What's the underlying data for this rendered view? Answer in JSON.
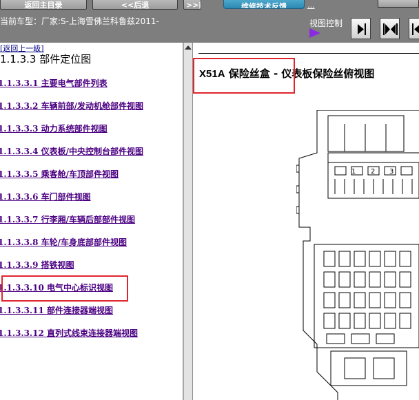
{
  "toolbar": {
    "home_label": "返回主目录",
    "back_label": "<<后退",
    "forward_label": ">>前进",
    "tech_feedback_label": "维修技术反馈",
    "tech_feedback_link": "...",
    "model_label": "当前车型：厂家:S-上海雪佛兰科鲁兹2011-",
    "view_control_label": "视图控制"
  },
  "nav": {
    "up_link": "[返回上一级]",
    "section_title": "1.1.3.3 部件定位图",
    "items": [
      {
        "label": "1.1.3.3.1 主要电气部件列表"
      },
      {
        "label": "1.1.3.3.2 车辆前部/发动机舱部件视图"
      },
      {
        "label": "1.1.3.3.3 动力系统部件视图"
      },
      {
        "label": "1.1.3.3.4 仪表板/中央控制台部件视图"
      },
      {
        "label": "1.1.3.3.5 乘客舱/车顶部件视图"
      },
      {
        "label": "1.1.3.3.6 车门部件视图"
      },
      {
        "label": "1.1.3.3.7 行李厢/车辆后部部件视图"
      },
      {
        "label": "1.1.3.3.8 车轮/车身底部部件视图"
      },
      {
        "label": "1.1.3.3.9 搭铁视图"
      },
      {
        "label": "1.1.3.3.10 电气中心标识视图"
      },
      {
        "label": "1.1.3.3.11 部件连接器端视图"
      },
      {
        "label": "1.1.3.3.12 直列式线束连接器端视图"
      }
    ]
  },
  "content": {
    "title_code": "X51A",
    "title_text": " 保险丝盒 - 仪表板保险丝俯视图",
    "diagram_labels": [
      "1",
      "2",
      "3"
    ]
  },
  "colors": {
    "toolbar_bg": "#7e7e7e",
    "link_color": "#4b0082",
    "highlight": "#e0242c",
    "view_arrow": "#8a2be2"
  },
  "icons": {
    "view_next": "next-page-icon",
    "view_fit": "fit-width-icon",
    "view_last": "last-page-icon",
    "splitter": "collapse-up-icon"
  }
}
